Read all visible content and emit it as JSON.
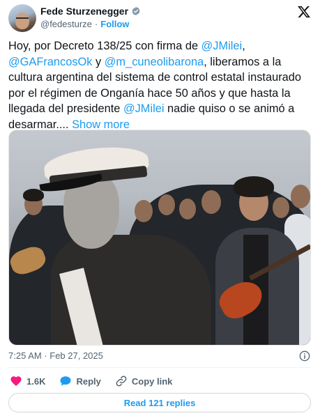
{
  "author": {
    "name": "Fede Sturzenegger",
    "handle": "@fedesturze",
    "separator": "·",
    "follow_label": "Follow",
    "verified": true
  },
  "post": {
    "text_segments": [
      {
        "text": "Hoy, por Decreto 138/25 con firma de ",
        "type": "plain"
      },
      {
        "text": "@JMilei",
        "type": "mention"
      },
      {
        "text": ", ",
        "type": "plain"
      },
      {
        "text": "@GAFrancosOk",
        "type": "mention"
      },
      {
        "text": " y ",
        "type": "plain"
      },
      {
        "text": "@m_cuneolibarona",
        "type": "mention"
      },
      {
        "text": ", liberamos a la cultura argentina del sistema de control estatal instaurado por el régimen de Onganía hace 50 años y que hasta la llegada del presidente ",
        "type": "plain"
      },
      {
        "text": "@JMilei",
        "type": "mention"
      },
      {
        "text": " nadie quiso o se animó a desarmar.... ",
        "type": "plain"
      }
    ],
    "show_more_label": "Show more",
    "timestamp": "7:25 AM · Feb 27, 2025"
  },
  "actions": {
    "like_count": "1.6K",
    "reply_label": "Reply",
    "copy_link_label": "Copy link"
  },
  "footer": {
    "read_replies_label": "Read 121 replies"
  },
  "colors": {
    "accent": "#1d9bf0",
    "like_heart": "#f91880",
    "text_primary": "#0f1419",
    "text_secondary": "#536471"
  },
  "icons": {
    "verified": "verified-badge-icon",
    "brand": "x-logo-icon",
    "info": "info-icon",
    "like": "heart-icon",
    "reply": "speech-bubble-icon",
    "copy_link": "link-icon"
  }
}
